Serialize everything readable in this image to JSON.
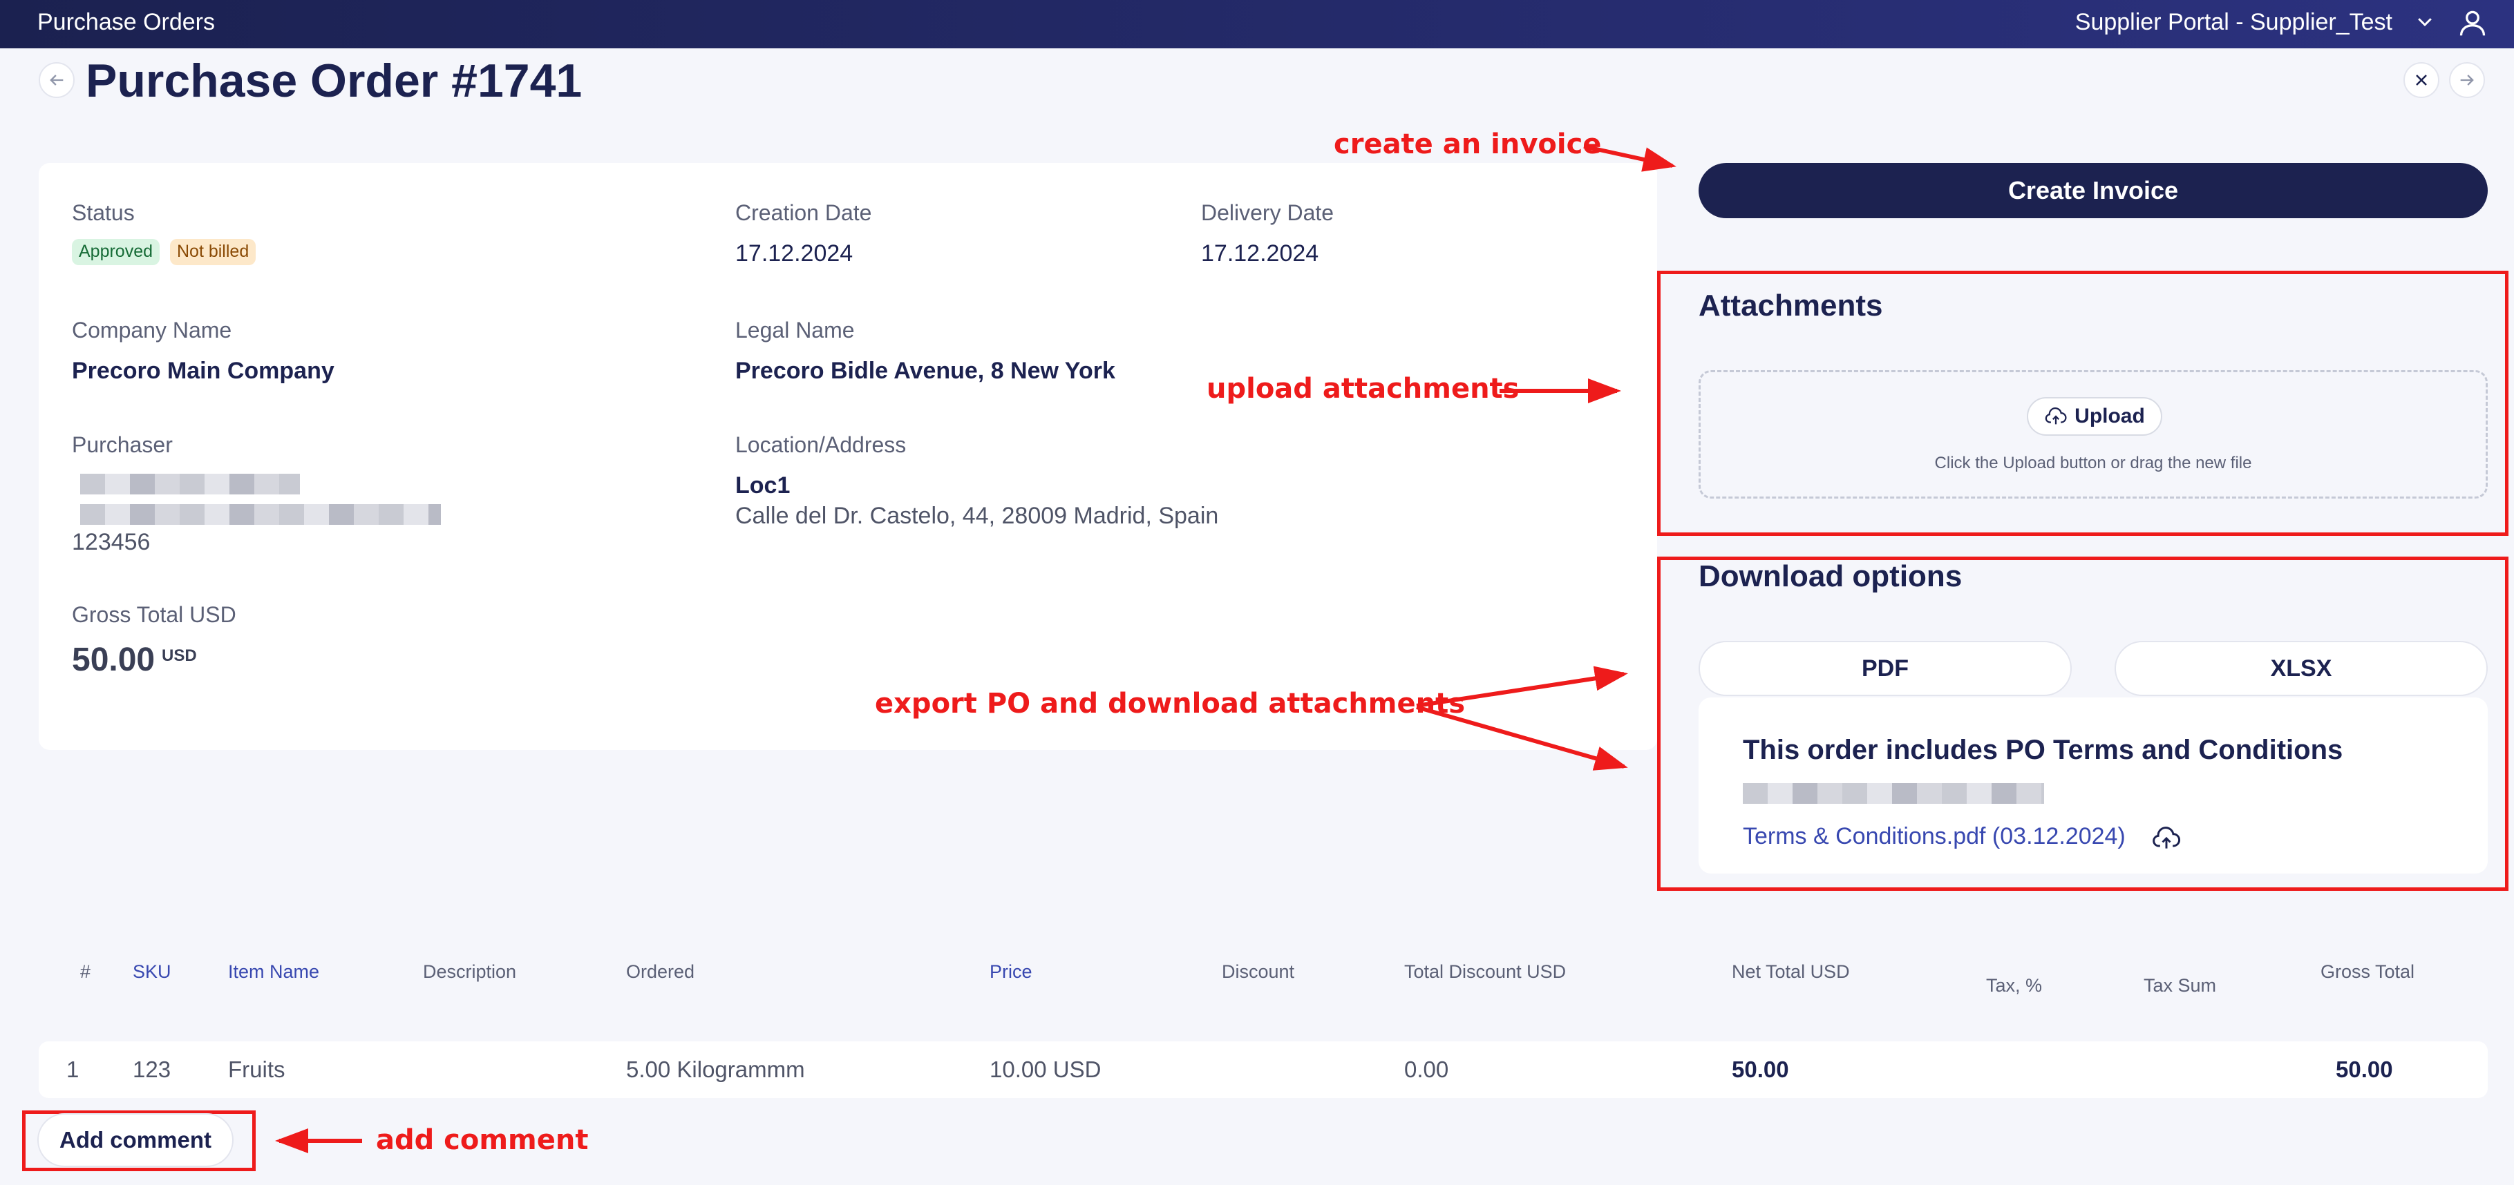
{
  "header": {
    "app_title": "Purchase Orders",
    "portal_label": "Supplier Portal - Supplier_Test"
  },
  "page": {
    "title": "Purchase Order #1741"
  },
  "details": {
    "status_label": "Status",
    "status_badges": [
      "Approved",
      "Not billed"
    ],
    "creation_date_label": "Creation Date",
    "creation_date": "17.12.2024",
    "delivery_date_label": "Delivery Date",
    "delivery_date": "17.12.2024",
    "company_name_label": "Company Name",
    "company_name": "Precoro Main Company",
    "legal_name_label": "Legal Name",
    "legal_name": "Precoro Bidle Avenue, 8 New York",
    "purchaser_label": "Purchaser",
    "purchaser_phone": "123456",
    "location_label": "Location/Address",
    "location_name": "Loc1",
    "location_address": "Calle del Dr. Castelo, 44, 28009 Madrid, Spain",
    "gross_total_label": "Gross Total USD",
    "gross_total_value": "50.00",
    "gross_total_currency": "USD"
  },
  "actions": {
    "create_invoice": "Create Invoice",
    "add_comment": "Add comment"
  },
  "attachments": {
    "title": "Attachments",
    "upload_label": "Upload",
    "hint": "Click the Upload button or drag the new file"
  },
  "downloads": {
    "title": "Download options",
    "pdf_label": "PDF",
    "xlsx_label": "XLSX",
    "terms_title": "This order includes PO Terms and Conditions",
    "terms_file": "Terms & Conditions.pdf (03.12.2024)"
  },
  "table": {
    "headers": [
      "#",
      "SKU",
      "Item Name",
      "Description",
      "Ordered",
      "Price",
      "Discount",
      "Total Discount USD",
      "Net Total USD",
      "Tax, %",
      "Tax Sum",
      "Gross Total"
    ],
    "rows": [
      [
        "1",
        "123",
        "Fruits",
        "",
        "5.00 Kilogrammm",
        "10.00 USD",
        "",
        "0.00",
        "50.00",
        "",
        "",
        "50.00"
      ]
    ]
  },
  "annotations": {
    "create_invoice": "create an invoice",
    "upload": "upload attachments",
    "export": "export PO and download attachments",
    "comment": "add comment"
  },
  "colors": {
    "primary": "#1c2250",
    "annotation": "#ee1b1b",
    "link": "#3848b0",
    "approved_bg": "#d9f4e2",
    "not_billed_bg": "#fde8c9"
  },
  "icons": [
    "chevron-down-icon",
    "user-icon",
    "arrow-left-icon",
    "close-icon",
    "arrow-right-icon",
    "cloud-upload-icon"
  ]
}
